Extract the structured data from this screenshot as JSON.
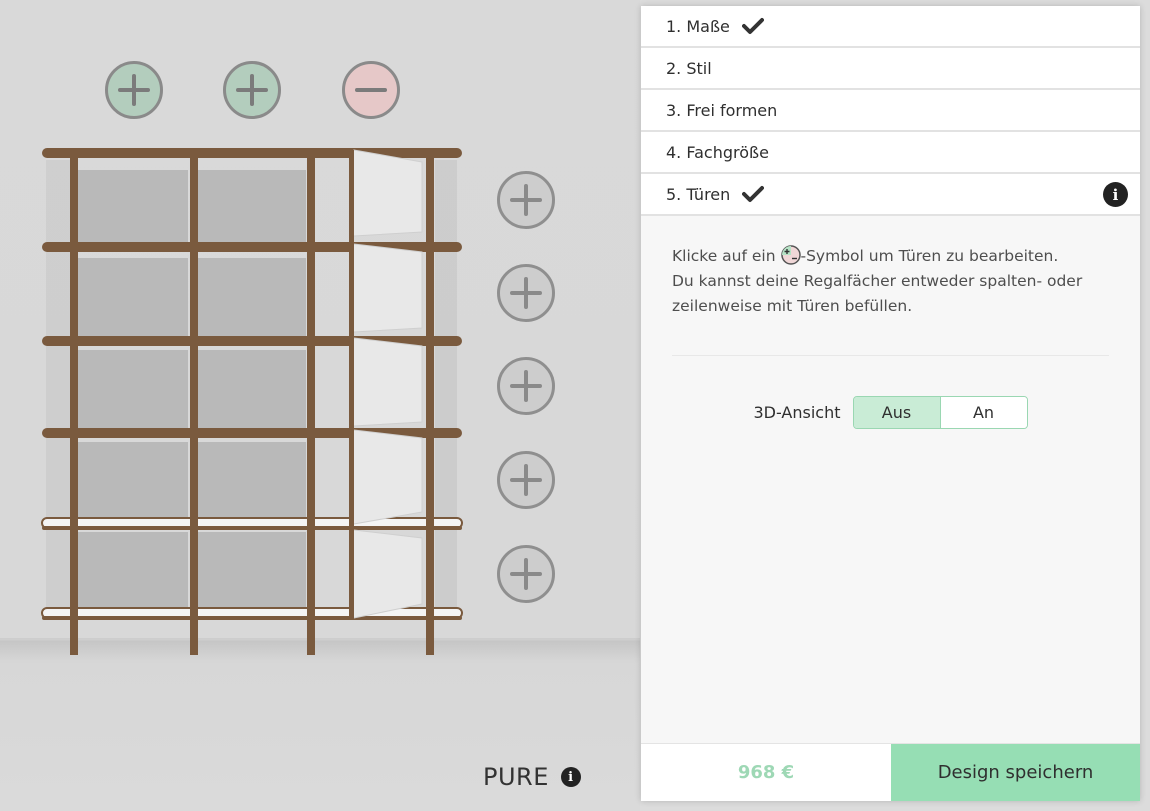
{
  "steps": [
    {
      "label": "1. Maße",
      "checked": true
    },
    {
      "label": "2. Stil",
      "checked": false
    },
    {
      "label": "3. Frei formen",
      "checked": false
    },
    {
      "label": "4. Fachgröße",
      "checked": false
    },
    {
      "label": "5. Türen",
      "checked": true
    }
  ],
  "description": {
    "part1": "Klicke auf ein ",
    "part2": "-Symbol um Türen zu bearbeiten.",
    "line2": "Du kannst deine Regalfächer entweder spalten- oder zeilenweise mit Türen befüllen."
  },
  "view_toggle": {
    "label": "3D-Ansicht",
    "options": [
      "Aus",
      "An"
    ],
    "selected": "Aus"
  },
  "footer": {
    "price": "968 €",
    "save_label": "Design speichern"
  },
  "brand": "PURE",
  "icons": {
    "info": "i",
    "check": "check-icon",
    "add": "plus-circle-icon",
    "remove": "minus-circle-icon"
  },
  "colors": {
    "accent_green": "#96deb4",
    "price_green": "#9ed8b5",
    "wood": "#7a5a3e"
  }
}
